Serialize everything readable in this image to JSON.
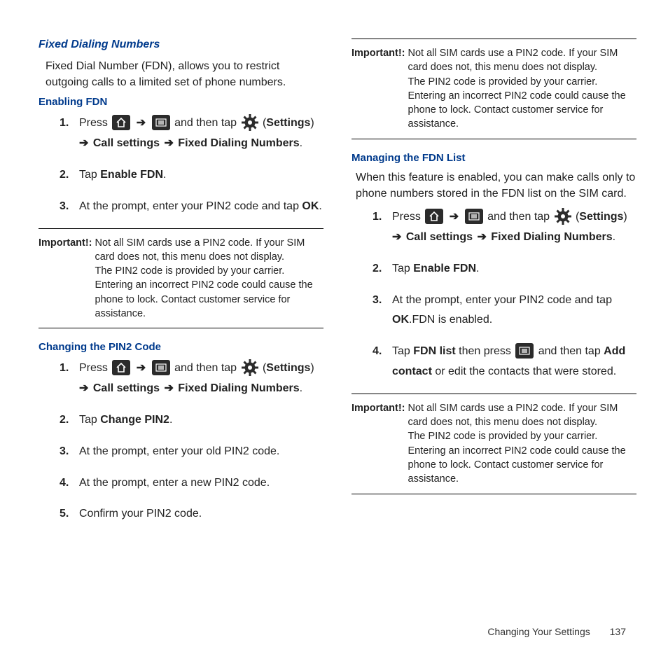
{
  "left": {
    "title": "Fixed Dialing Numbers",
    "intro": "Fixed Dial Number (FDN), allows you to restrict outgoing calls to a limited set of phone numbers.",
    "enabling": {
      "heading": "Enabling FDN",
      "step1_press": "Press ",
      "step1_arrow": " ➔ ",
      "step1_andthen": " and then tap ",
      "step1_settings": "Settings",
      "step1_arrow2": " ➔ ",
      "step1_call": "Call settings",
      "step1_arrow3": "  ➔ ",
      "step1_fdn": "Fixed Dialing Numbers",
      "step1_period": ".",
      "step2_a": "Tap ",
      "step2_b": "Enable FDN",
      "step2_c": ".",
      "step3_a": "At the prompt, enter your PIN2 code and tap ",
      "step3_b": "OK",
      "step3_c": "."
    },
    "important1": {
      "label": "Important!:",
      "line1": "Not all SIM cards use a PIN2 code. If your SIM card does not, this menu does not display.",
      "line2": "The PIN2 code is provided by your carrier. Entering an incorrect PIN2 code could cause the phone to lock. Contact customer service for assistance."
    },
    "changing": {
      "heading": "Changing the PIN2 Code",
      "step1_press": "Press ",
      "step1_arrow": " ➔ ",
      "step1_andthen": " and then tap ",
      "step1_settings": "Settings",
      "step1_arrow2": " ➔ ",
      "step1_call": "Call settings",
      "step1_arrow3": "  ➔ ",
      "step1_fdn": "Fixed Dialing Numbers",
      "step1_period": ".",
      "step2_a": "Tap ",
      "step2_b": "Change PIN2",
      "step2_c": ".",
      "step3": "At the prompt, enter your old PIN2 code.",
      "step4": "At the prompt, enter a new PIN2 code.",
      "step5": "Confirm your PIN2 code."
    }
  },
  "right": {
    "important1": {
      "label": "Important!:",
      "line1": "Not all SIM cards use a PIN2 code. If your SIM card does not, this menu does not display.",
      "line2": "The PIN2 code is provided by your carrier. Entering an incorrect PIN2 code could cause the phone to lock. Contact customer service for assistance."
    },
    "managing": {
      "heading": "Managing the FDN List",
      "intro": "When this feature is enabled, you can make calls only to phone numbers stored in the FDN list on the SIM card.",
      "step1_press": "Press ",
      "step1_arrow": " ➔ ",
      "step1_andthen": " and then tap ",
      "step1_settings": "Settings",
      "step1_arrow2": " ➔ ",
      "step1_call": "Call settings",
      "step1_arrow3": "  ➔ ",
      "step1_fdn": "Fixed Dialing Numbers",
      "step1_period": ".",
      "step2_a": "Tap ",
      "step2_b": "Enable FDN",
      "step2_c": ".",
      "step3_a": "At the prompt, enter your PIN2 code and tap ",
      "step3_b": "OK",
      "step3_c": ".FDN is enabled.",
      "step4_a": "Tap ",
      "step4_b": "FDN list",
      "step4_c": " then press ",
      "step4_d": " and then tap ",
      "step4_e": "Add contact",
      "step4_f": " or edit the contacts that were stored."
    },
    "important2": {
      "label": "Important!:",
      "line1": "Not all SIM cards use a PIN2 code. If your SIM card does not, this menu does not display.",
      "line2": "The PIN2 code is provided by your carrier. Entering an incorrect PIN2 code could cause the phone to lock. Contact customer service for assistance."
    }
  },
  "footer": {
    "chapter": "Changing Your Settings",
    "page": "137"
  }
}
